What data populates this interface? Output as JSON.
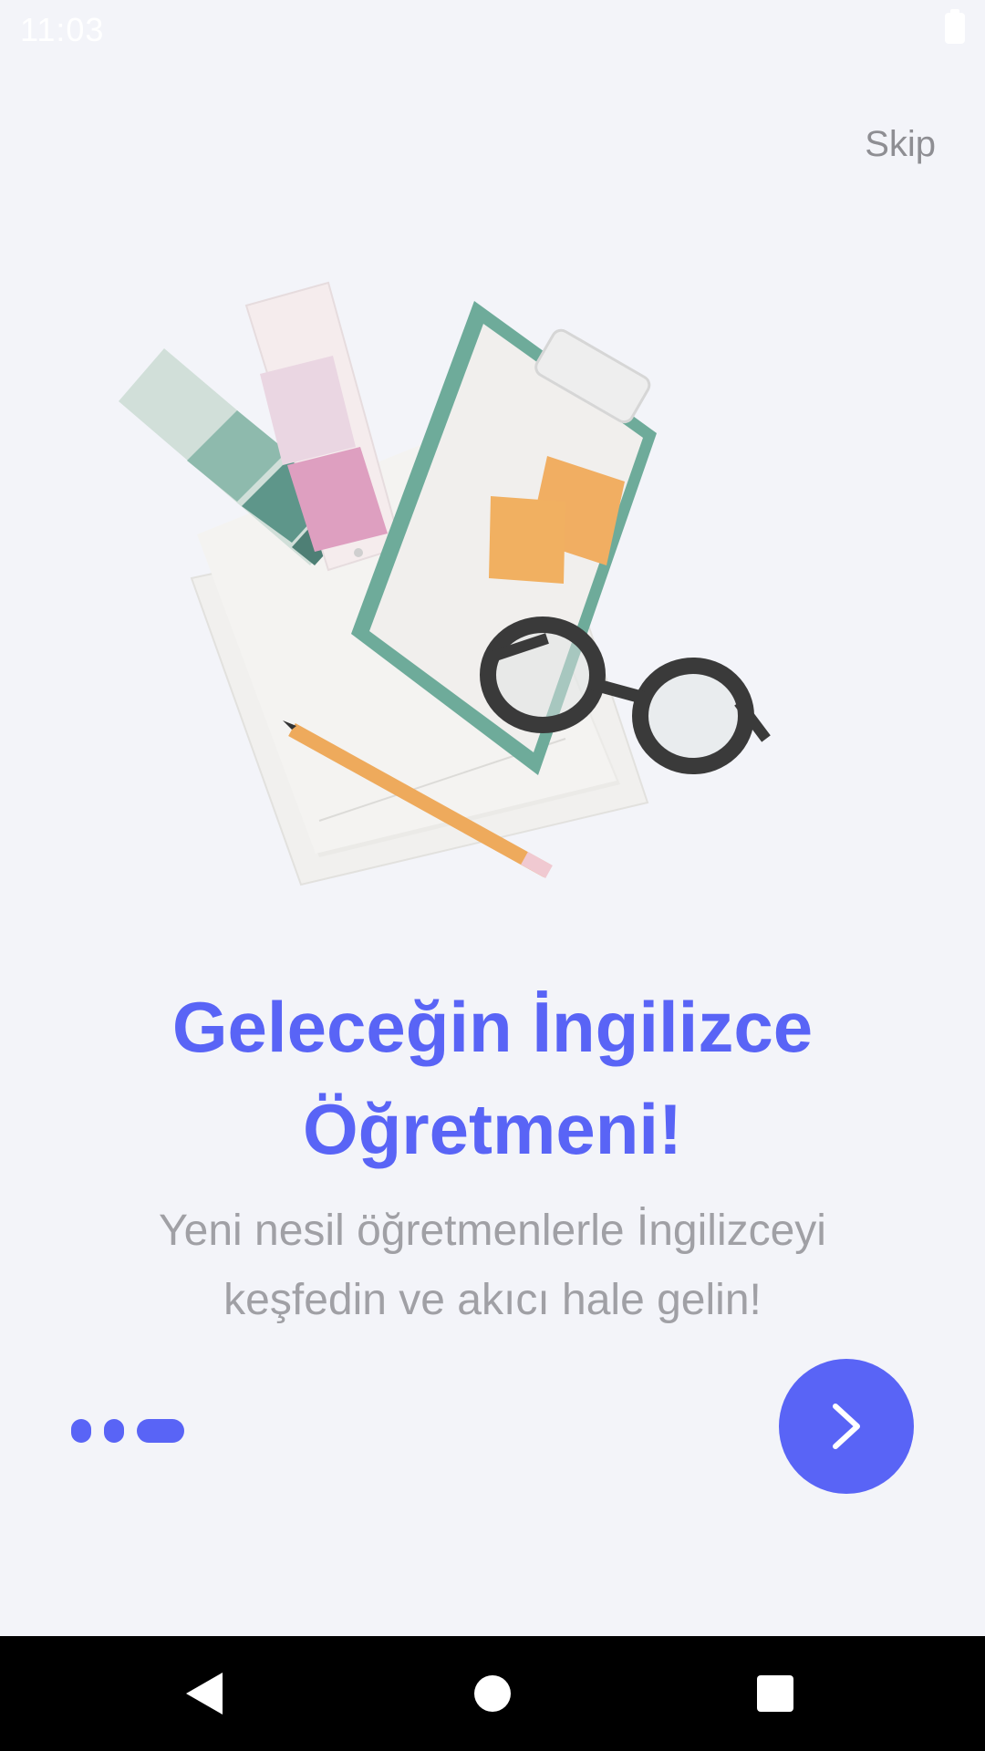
{
  "status_bar": {
    "time": "11:03",
    "battery_icon": "battery-full-icon"
  },
  "skip_label": "Skip",
  "onboarding": {
    "title": "Geleceğin İngilizce Öğretmeni!",
    "subtitle": "Yeni nesil öğretmenlerle İngilizceyi keşfedin ve akıcı hale gelin!",
    "page_count": 3,
    "current_page": 3,
    "next_icon": "chevron-right-icon",
    "illustration_icon": "stationery-desk-illustration"
  },
  "nav_bar": {
    "back_icon": "back-triangle-icon",
    "home_icon": "home-circle-icon",
    "recents_icon": "recents-square-icon"
  },
  "colors": {
    "accent": "#5964f6",
    "background": "#f3f4f9",
    "text_muted": "#a0a0a5",
    "skip": "#8e8e93"
  }
}
